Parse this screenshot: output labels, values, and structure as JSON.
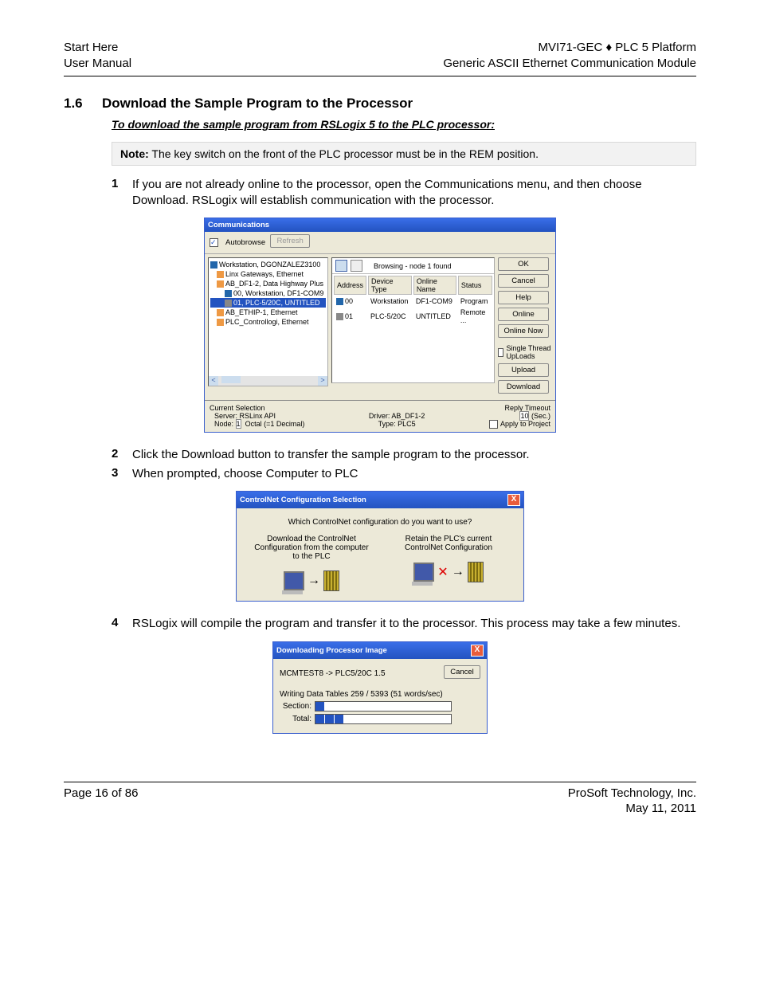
{
  "header": {
    "left1": "Start Here",
    "left2": "User Manual",
    "right1": "MVI71-GEC ♦ PLC 5 Platform",
    "right2": "Generic ASCII Ethernet Communication Module"
  },
  "section": {
    "num": "1.6",
    "title": "Download the Sample Program to the Processor",
    "sub": "To download the sample program from RSLogix 5 to the PLC processor:"
  },
  "note": {
    "label": "Note:",
    "text": " The key switch on the front of the PLC processor must be in the REM position."
  },
  "steps": {
    "s1n": "1",
    "s1t": "If you are not already online to the processor, open the Communications menu, and then choose Download. RSLogix will establish communication with the processor.",
    "s2n": "2",
    "s2t": "Click the Download button to transfer the sample program to the processor.",
    "s3n": "3",
    "s3t": "When prompted, choose Computer to PLC",
    "s4n": "4",
    "s4t": "RSLogix will compile the program and transfer it to the processor. This process may take a few minutes."
  },
  "comm": {
    "title": "Communications",
    "autobrowse": "Autobrowse",
    "refresh": "Refresh",
    "browsing": "Browsing - node 1 found",
    "tree": {
      "t0": "Workstation, DGONZALEZ3100",
      "t1": "Linx Gateways, Ethernet",
      "t2": "AB_DF1-2, Data Highway Plus",
      "t3": "00, Workstation, DF1-COM9",
      "t4": "01, PLC-5/20C, UNTITLED",
      "t5": "AB_ETHIP-1, Ethernet",
      "t6": "PLC_Controllogi, Ethernet"
    },
    "cols": {
      "c1": "Address",
      "c2": "Device Type",
      "c3": "Online Name",
      "c4": "Status"
    },
    "row1": {
      "a": "00",
      "d": "Workstation",
      "o": "DF1-COM9",
      "s": "Program"
    },
    "row2": {
      "a": "01",
      "d": "PLC-5/20C",
      "o": "UNTITLED",
      "s": "Remote ..."
    },
    "buttons": {
      "ok": "OK",
      "cancel": "Cancel",
      "help": "Help",
      "online": "Online",
      "onlinenow": "Online Now",
      "single": "Single Thread UpLoads",
      "upload": "Upload",
      "download": "Download"
    },
    "bottom": {
      "cs": "Current Selection",
      "server": "Server: RSLinx API",
      "nodeL": "Node:",
      "nodeV": "1",
      "octal": "Octal (=1 Decimal)",
      "driver": "Driver: AB_DF1-2",
      "type": "Type: PLC5",
      "rt": "Reply Timeout",
      "rtV": "10",
      "sec": "(Sec.)",
      "apply": "Apply to Project"
    }
  },
  "cnet": {
    "title": "ControlNet Configuration Selection",
    "q": "Which ControlNet configuration do you want to use?",
    "left": "Download the ControlNet Configuration from the computer to the PLC",
    "right": "Retain the PLC's current ControlNet Configuration"
  },
  "dl": {
    "title": "Downloading Processor Image",
    "transfer": "MCMTEST8 -> PLC5/20C 1.5",
    "cancel": "Cancel",
    "writing": "Writing Data Tables 259 / 5393 (51 words/sec)",
    "section": "Section:",
    "total": "Total:"
  },
  "footer": {
    "left": "Page 16 of 86",
    "right1": "ProSoft Technology, Inc.",
    "right2": "May 11, 2011"
  }
}
